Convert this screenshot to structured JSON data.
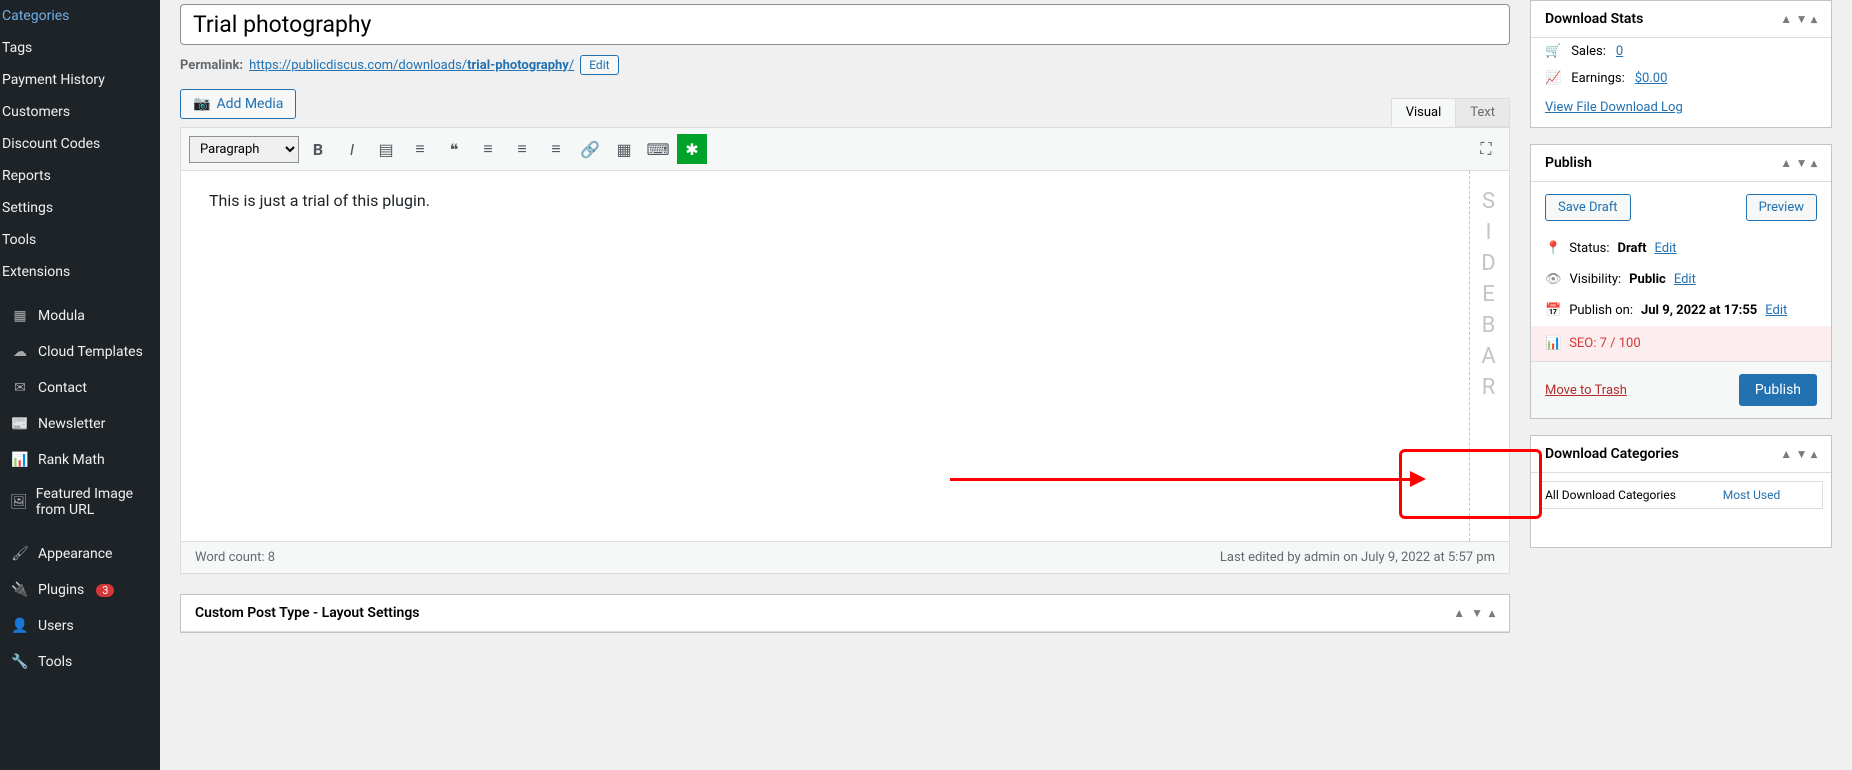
{
  "sidebar": {
    "items": [
      {
        "label": "Categories"
      },
      {
        "label": "Tags"
      },
      {
        "label": "Payment History"
      },
      {
        "label": "Customers"
      },
      {
        "label": "Discount Codes"
      },
      {
        "label": "Reports"
      },
      {
        "label": "Settings"
      },
      {
        "label": "Tools"
      },
      {
        "label": "Extensions"
      }
    ],
    "main_items": [
      {
        "label": "Modula",
        "icon": "grid"
      },
      {
        "label": "Cloud Templates",
        "icon": "cloud"
      },
      {
        "label": "Contact",
        "icon": "mail"
      },
      {
        "label": "Newsletter",
        "icon": "newsletter"
      },
      {
        "label": "Rank Math",
        "icon": "chart"
      },
      {
        "label": "Featured Image from URL",
        "icon": "image"
      }
    ],
    "bottom_items": [
      {
        "label": "Appearance",
        "icon": "brush"
      },
      {
        "label": "Plugins",
        "icon": "plug",
        "badge": "3"
      },
      {
        "label": "Users",
        "icon": "user"
      },
      {
        "label": "Tools",
        "icon": "wrench"
      }
    ]
  },
  "editor": {
    "title": "Trial photography",
    "permalink_label": "Permalink:",
    "permalink_base": "https://publicdiscus.com/downloads/",
    "permalink_slug": "trial-photography",
    "permalink_edit": "Edit",
    "add_media": "Add Media",
    "tabs": {
      "visual": "Visual",
      "text": "Text"
    },
    "paragraph": "Paragraph",
    "body_text": "This is just a trial of this plugin.",
    "sidebar_letters": [
      "S",
      "I",
      "D",
      "E",
      "B",
      "A",
      "R"
    ],
    "word_count_label": "Word count: 8",
    "last_edited": "Last edited by admin on July 9, 2022 at 5:57 pm",
    "custom_post_type": "Custom Post Type - Layout Settings"
  },
  "download_stats": {
    "title": "Download Stats",
    "sales_label": "Sales:",
    "sales_value": "0",
    "earnings_label": "Earnings:",
    "earnings_value": "$0.00",
    "view_log": "View File Download Log"
  },
  "publish": {
    "title": "Publish",
    "save_draft": "Save Draft",
    "preview": "Preview",
    "status_label": "Status:",
    "status_value": "Draft",
    "visibility_label": "Visibility:",
    "visibility_value": "Public",
    "publish_on_label": "Publish on:",
    "publish_on_value": "Jul 9, 2022 at 17:55",
    "edit_link": "Edit",
    "seo_label": "SEO: 7 / 100",
    "trash": "Move to Trash",
    "publish_btn": "Publish"
  },
  "categories": {
    "title": "Download Categories",
    "tab_all": "All Download Categories",
    "tab_used": "Most Used"
  }
}
